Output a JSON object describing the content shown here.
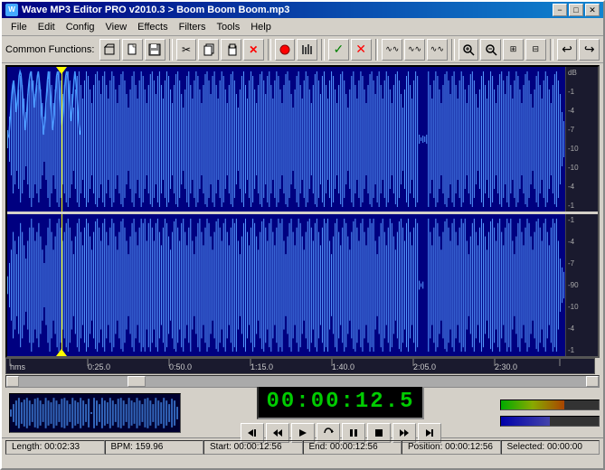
{
  "titleBar": {
    "title": "Wave MP3 Editor PRO v2010.3 > Boom Boom Boom.mp3",
    "minBtn": "−",
    "maxBtn": "□",
    "closeBtn": "✕"
  },
  "menuBar": {
    "items": [
      "File",
      "Edit",
      "Config",
      "View",
      "Effects",
      "Filters",
      "Tools",
      "Help"
    ]
  },
  "toolbar": {
    "label": "Common Functions:",
    "buttons": [
      {
        "name": "open",
        "icon": "📂"
      },
      {
        "name": "new",
        "icon": "📄"
      },
      {
        "name": "save",
        "icon": "💾"
      },
      {
        "name": "cut",
        "icon": "✂"
      },
      {
        "name": "copy",
        "icon": "📋"
      },
      {
        "name": "paste",
        "icon": "📋"
      },
      {
        "name": "delete",
        "icon": "✕"
      },
      {
        "name": "record",
        "icon": "⏺"
      },
      {
        "name": "level",
        "icon": "▌▌▌"
      },
      {
        "name": "check",
        "icon": "✓"
      },
      {
        "name": "cancel",
        "icon": "✕"
      },
      {
        "name": "wave1",
        "icon": "∿"
      },
      {
        "name": "wave2",
        "icon": "∿"
      },
      {
        "name": "wave3",
        "icon": "∿"
      },
      {
        "name": "zoom-in",
        "icon": "🔍"
      },
      {
        "name": "zoom-out",
        "icon": "🔍"
      },
      {
        "name": "zoom-fit",
        "icon": "⊞"
      },
      {
        "name": "zoom-sel",
        "icon": "⊟"
      },
      {
        "name": "undo",
        "icon": "↩"
      },
      {
        "name": "redo",
        "icon": "↪"
      }
    ]
  },
  "dbScale": {
    "top": {
      "labels": [
        "dB",
        "-1",
        "-4",
        "-7",
        "-10",
        "-10",
        "-4",
        "-1"
      ]
    },
    "bottom": {
      "labels": [
        "-1",
        "-4",
        "-7",
        "-90",
        "-10",
        "-4",
        "-1"
      ]
    }
  },
  "timeline": {
    "labels": [
      "hms",
      "0:25.0",
      "0:50.0",
      "1:15.0",
      "1:40.0",
      "2:05.0",
      "2:30.0"
    ]
  },
  "timeDisplay": "00:00:12.5",
  "transportButtons": [
    {
      "name": "go-start",
      "icon": "|◀"
    },
    {
      "name": "rewind",
      "icon": "◀◀"
    },
    {
      "name": "play",
      "icon": "▶"
    },
    {
      "name": "loop",
      "icon": "↻"
    },
    {
      "name": "pause",
      "icon": "⏸"
    },
    {
      "name": "stop",
      "icon": "■"
    },
    {
      "name": "forward",
      "icon": "▶▶"
    },
    {
      "name": "go-end",
      "icon": "▶|"
    }
  ],
  "statusBar": {
    "length": "Length: 00:02:33",
    "bpm": "BPM: 159.96",
    "start": "Start: 00:00:12:56",
    "end": "End: 00:00:12:56",
    "position": "Position: 00:00:12:56",
    "selected": "Selected: 00:00:00"
  }
}
